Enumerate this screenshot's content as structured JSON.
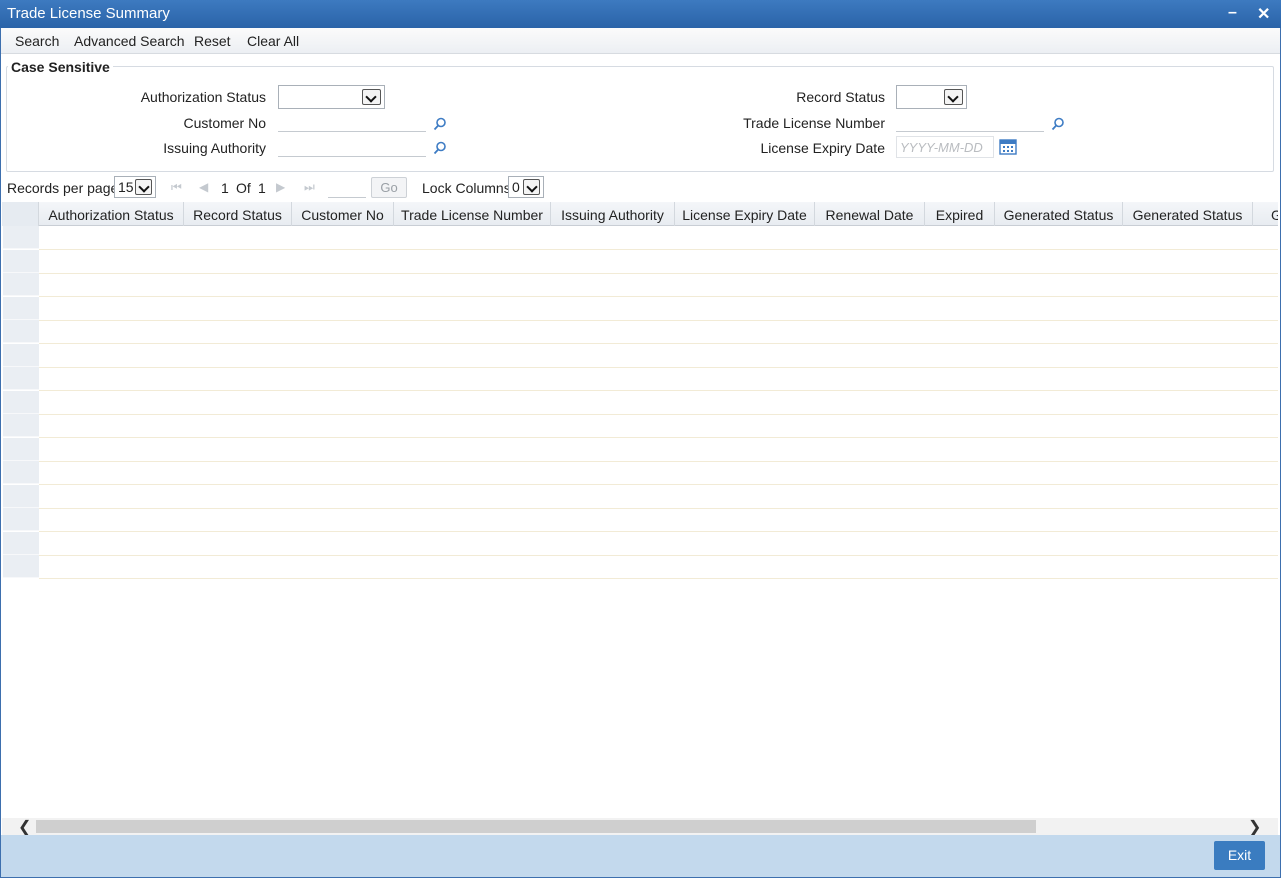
{
  "window": {
    "title": "Trade License Summary",
    "minimize": "–",
    "close": "✕"
  },
  "toolbar": {
    "search": "Search",
    "advanced_search": "Advanced Search",
    "reset": "Reset",
    "clear_all": "Clear All"
  },
  "criteria": {
    "legend": "Case Sensitive",
    "authorization_status": {
      "label": "Authorization Status",
      "value": ""
    },
    "record_status": {
      "label": "Record Status",
      "value": ""
    },
    "customer_no": {
      "label": "Customer No",
      "value": ""
    },
    "trade_license_number": {
      "label": "Trade License Number",
      "value": ""
    },
    "issuing_authority": {
      "label": "Issuing Authority",
      "value": ""
    },
    "license_expiry_date": {
      "label": "License Expiry Date",
      "placeholder": "YYYY-MM-DD"
    }
  },
  "pager": {
    "records_per_page_label": "Records per page",
    "records_per_page": "15",
    "current_page": "1",
    "of_label": "Of",
    "total_pages": "1",
    "go_label": "Go",
    "lock_columns_label": "Lock Columns",
    "lock_columns": "0"
  },
  "grid": {
    "columns": [
      "Authorization Status",
      "Record Status",
      "Customer No",
      "Trade License Number",
      "Issuing Authority",
      "License Expiry Date",
      "Renewal Date",
      "Expired",
      "Generated Status",
      "Generated Status",
      "G"
    ],
    "rows": []
  },
  "footer": {
    "exit": "Exit"
  },
  "colors": {
    "titlebar": "#2f6bb0",
    "footer": "#c3d9ed",
    "exit_button": "#3a7cc0"
  },
  "icons": {
    "lookup": "magnifier-icon",
    "calendar": "calendar-icon"
  }
}
